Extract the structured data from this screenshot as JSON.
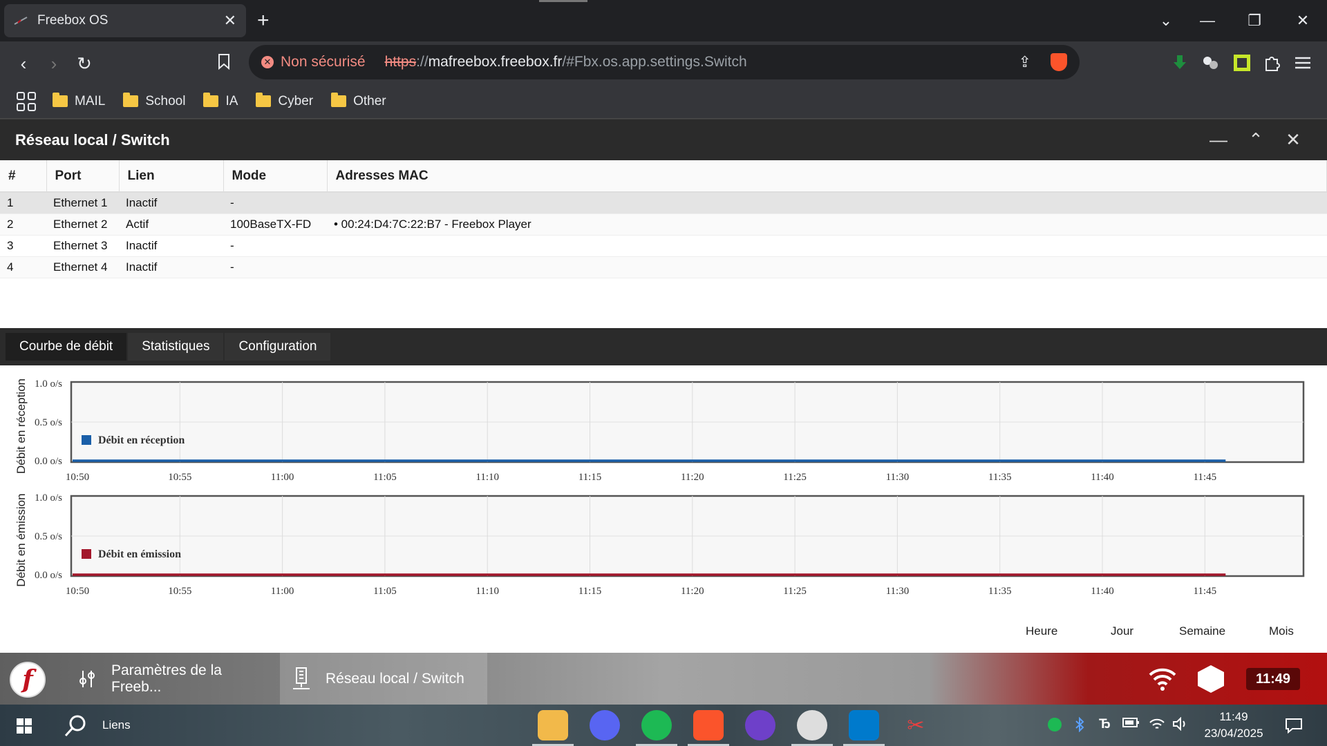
{
  "browser": {
    "tab_title": "Freebox OS",
    "security_label": "Non sécurisé",
    "url_scheme": "https",
    "url_separator": "://",
    "url_host": "mafreebox.freebox.fr",
    "url_path": "/#Fbx.os.app.settings.Switch",
    "bookmarks": [
      "MAIL",
      "School",
      "IA",
      "Cyber",
      "Other"
    ]
  },
  "window": {
    "title": "Réseau local / Switch"
  },
  "table": {
    "headers": [
      "#",
      "Port",
      "Lien",
      "Mode",
      "Adresses MAC"
    ],
    "rows": [
      {
        "num": "1",
        "port": "Ethernet 1",
        "link": "Inactif",
        "mode": "-",
        "mac": ""
      },
      {
        "num": "2",
        "port": "Ethernet 2",
        "link": "Actif",
        "mode": "100BaseTX-FD",
        "mac": "• 00:24:D4:7C:22:B7 - Freebox Player"
      },
      {
        "num": "3",
        "port": "Ethernet 3",
        "link": "Inactif",
        "mode": "-",
        "mac": ""
      },
      {
        "num": "4",
        "port": "Ethernet 4",
        "link": "Inactif",
        "mode": "-",
        "mac": ""
      }
    ]
  },
  "subtabs": [
    "Courbe de débit",
    "Statistiques",
    "Configuration"
  ],
  "periods": [
    "Heure",
    "Jour",
    "Semaine",
    "Mois"
  ],
  "chart_data": [
    {
      "type": "area",
      "ylabel": "Débit en réception",
      "yticks": [
        "1.0 o/s",
        "0.5 o/s",
        "0.0 o/s"
      ],
      "ylim": [
        0,
        1
      ],
      "categories": [
        "10:50",
        "10:55",
        "11:00",
        "11:05",
        "11:10",
        "11:15",
        "11:20",
        "11:25",
        "11:30",
        "11:35",
        "11:40",
        "11:45"
      ],
      "series": [
        {
          "name": "Débit en réception",
          "color": "#1a5fa8",
          "values": [
            0,
            0,
            0,
            0,
            0,
            0,
            0,
            0,
            0,
            0,
            0,
            0
          ]
        }
      ],
      "legend": "bottom-left",
      "grid": true
    },
    {
      "type": "area",
      "ylabel": "Débit en émission",
      "yticks": [
        "1.0 o/s",
        "0.5 o/s",
        "0.0 o/s"
      ],
      "ylim": [
        0,
        1
      ],
      "categories": [
        "10:50",
        "10:55",
        "11:00",
        "11:05",
        "11:10",
        "11:15",
        "11:20",
        "11:25",
        "11:30",
        "11:35",
        "11:40",
        "11:45"
      ],
      "series": [
        {
          "name": "Débit en émission",
          "color": "#a3172b",
          "values": [
            0,
            0,
            0,
            0,
            0,
            0,
            0,
            0,
            0,
            0,
            0,
            0
          ]
        }
      ],
      "legend": "bottom-left",
      "grid": true
    }
  ],
  "dock": {
    "logo_letter": "f",
    "items": [
      "Paramètres de la Freeb...",
      "Réseau local / Switch"
    ],
    "clock": "11:49"
  },
  "taskbar": {
    "search_label": "Liens",
    "time": "11:49",
    "date": "23/04/2025"
  }
}
